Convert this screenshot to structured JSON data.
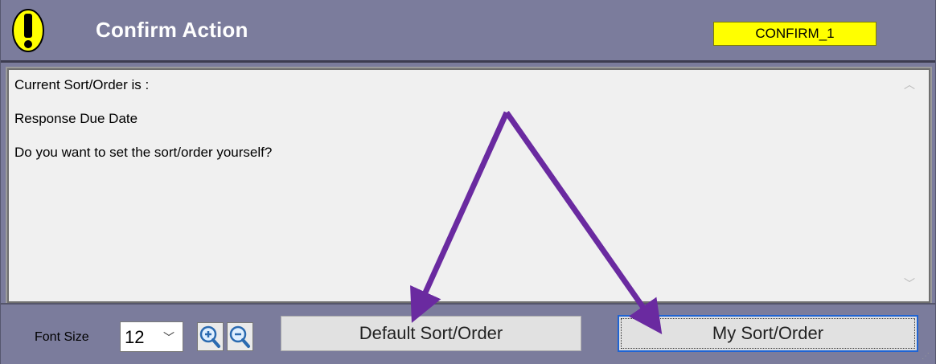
{
  "dialog": {
    "title": "Confirm Action",
    "badge": "CONFIRM_1",
    "message": "Current Sort/Order is :\n\nResponse Due Date\n\nDo you want to set the sort/order yourself?"
  },
  "footer": {
    "font_size_label": "Font Size",
    "font_size_value": "12",
    "default_button": "Default Sort/Order",
    "my_button": "My Sort/Order"
  },
  "icons": {
    "alert": "exclamation-icon",
    "zoom_in": "zoom-in-icon",
    "zoom_out": "zoom-out-icon",
    "dropdown": "chevron-down-icon",
    "scroll_up": "chevron-up-icon",
    "scroll_down": "chevron-down-icon"
  },
  "colors": {
    "titlebar": "#7b7c9c",
    "badge": "#ffff00",
    "alert_icon": "#ffff00",
    "annotation_arrows": "#6a2aa0"
  }
}
